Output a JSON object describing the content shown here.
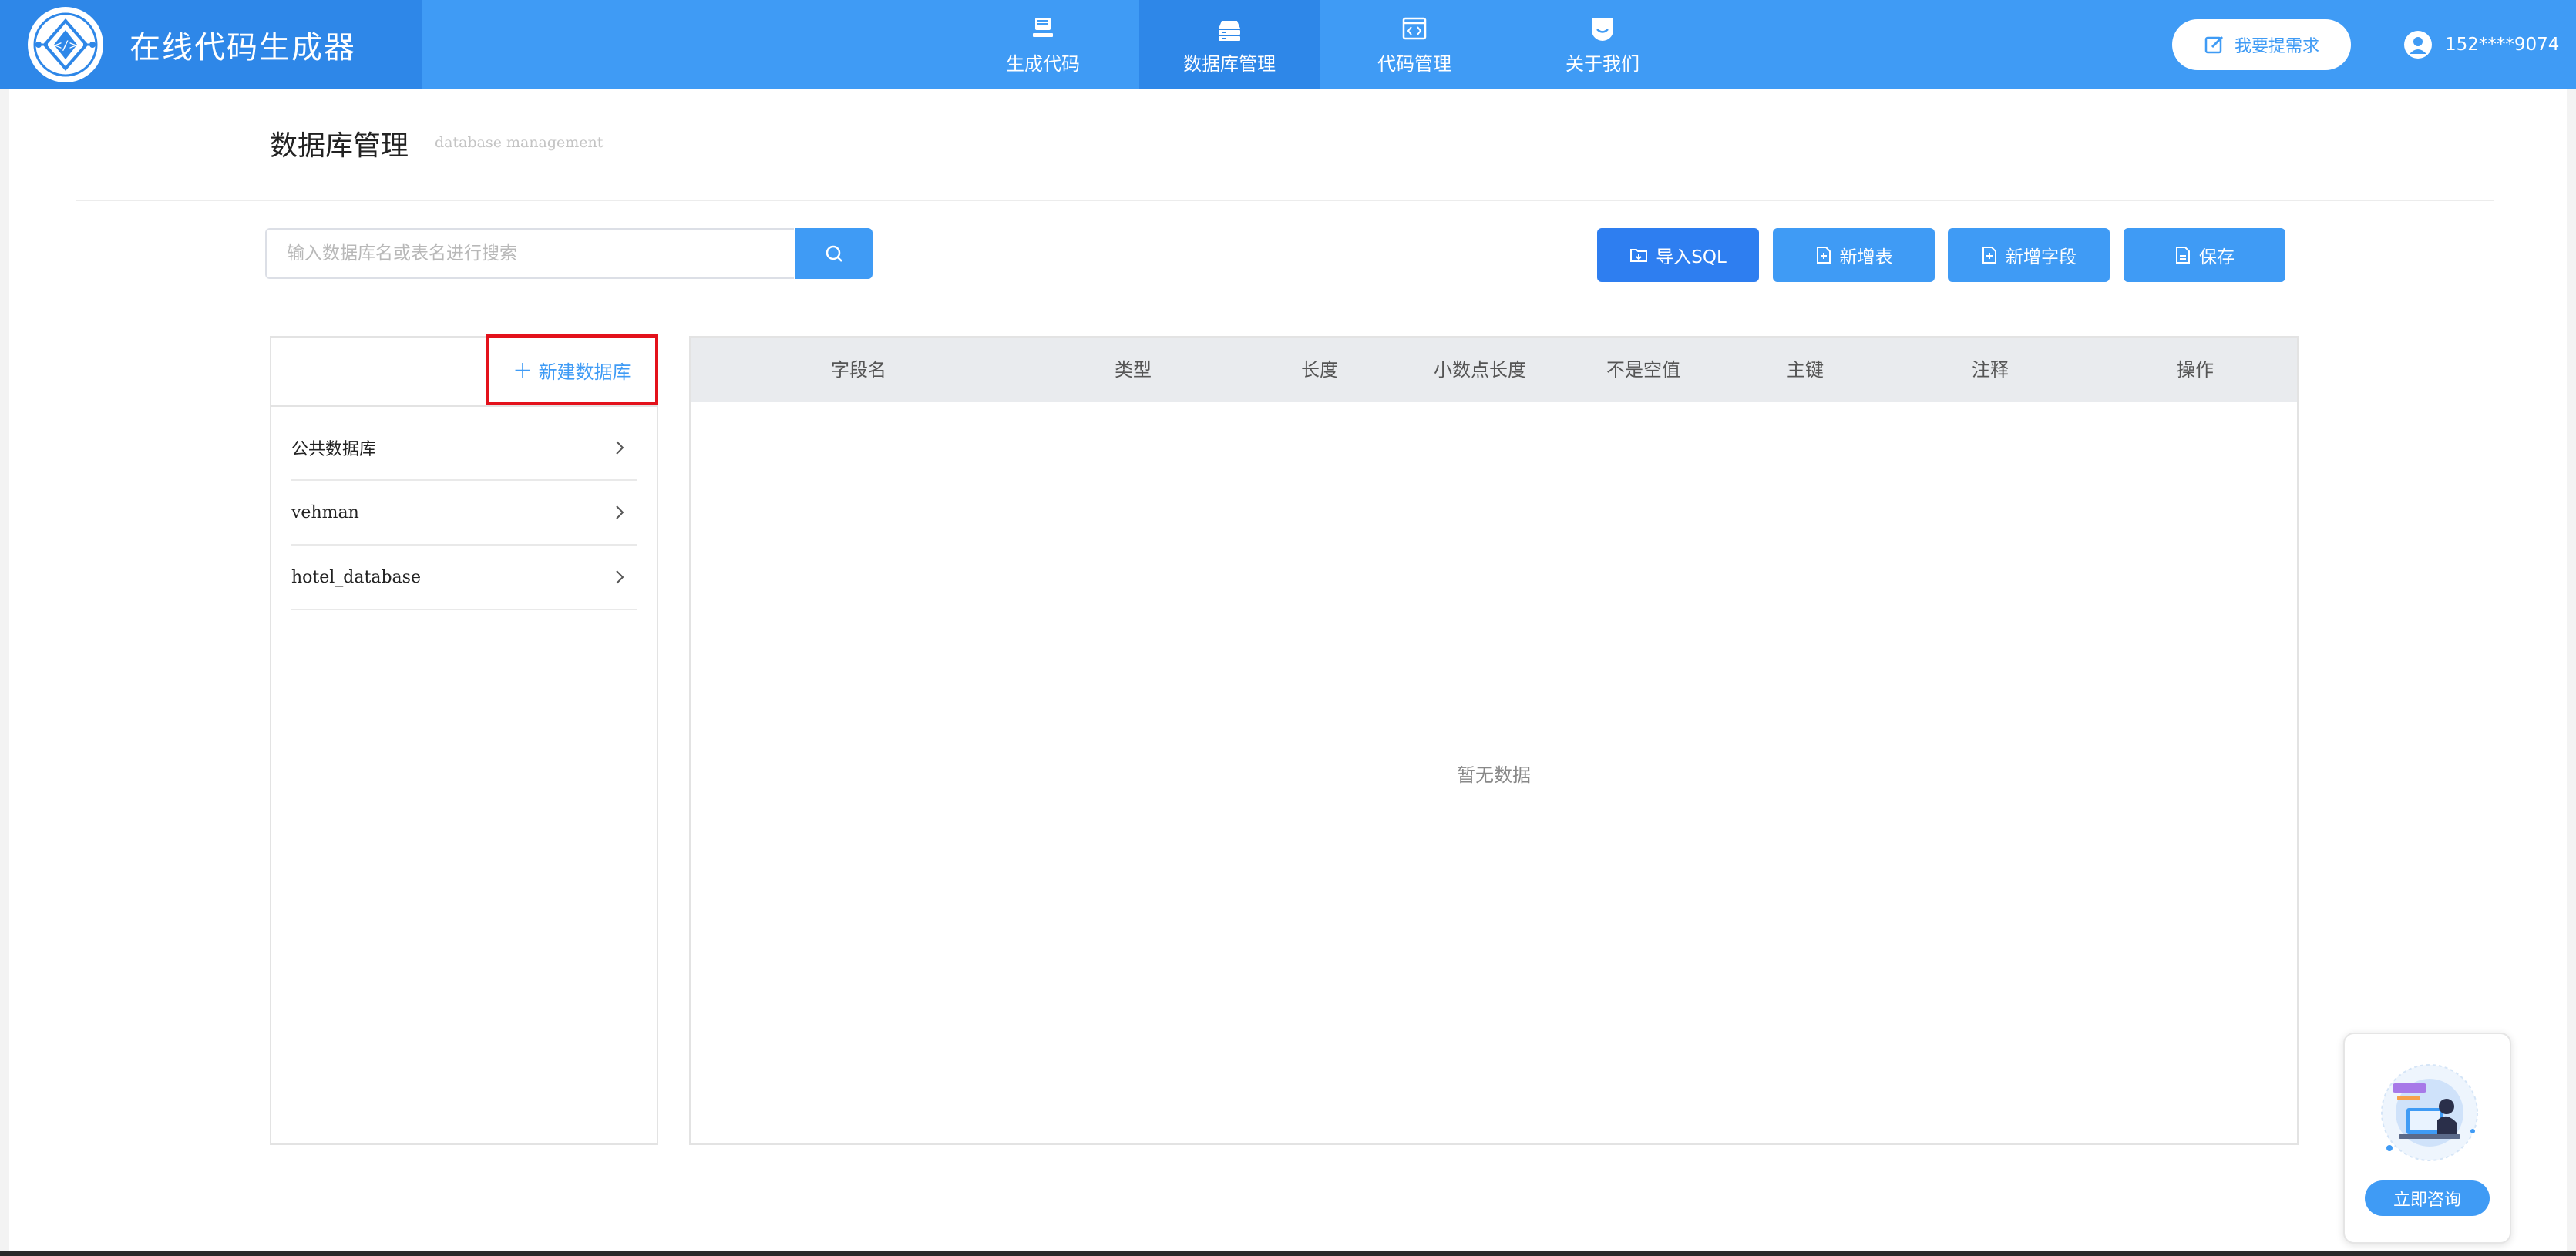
{
  "header": {
    "app_title": "在线代码生成器",
    "nav": [
      {
        "label": "生成代码",
        "icon": "computer-icon"
      },
      {
        "label": "数据库管理",
        "icon": "database-server-icon"
      },
      {
        "label": "代码管理",
        "icon": "code-window-icon"
      },
      {
        "label": "关于我们",
        "icon": "smile-icon"
      }
    ],
    "active_nav": "数据库管理",
    "request_button": "我要提需求",
    "user_phone": "152****9074"
  },
  "page": {
    "title": "数据库管理",
    "subtitle": "database management"
  },
  "search": {
    "placeholder": "输入数据库名或表名进行搜索",
    "value": ""
  },
  "toolbar": {
    "import_sql": "导入SQL",
    "add_table": "新增表",
    "add_field": "新增字段",
    "save": "保存"
  },
  "db_list": {
    "new_db_label": "新建数据库",
    "items": [
      "公共数据库",
      "vehman",
      "hotel_database"
    ]
  },
  "table": {
    "columns": [
      "字段名",
      "类型",
      "长度",
      "小数点长度",
      "不是空值",
      "主键",
      "注释",
      "操作"
    ],
    "rows": [],
    "empty_text": "暂无数据"
  },
  "consult": {
    "button_label": "立即咨询"
  },
  "colors": {
    "accent": "#3f9bf5",
    "accent_dark": "#2e87e8",
    "highlight_border": "#e3111b"
  }
}
